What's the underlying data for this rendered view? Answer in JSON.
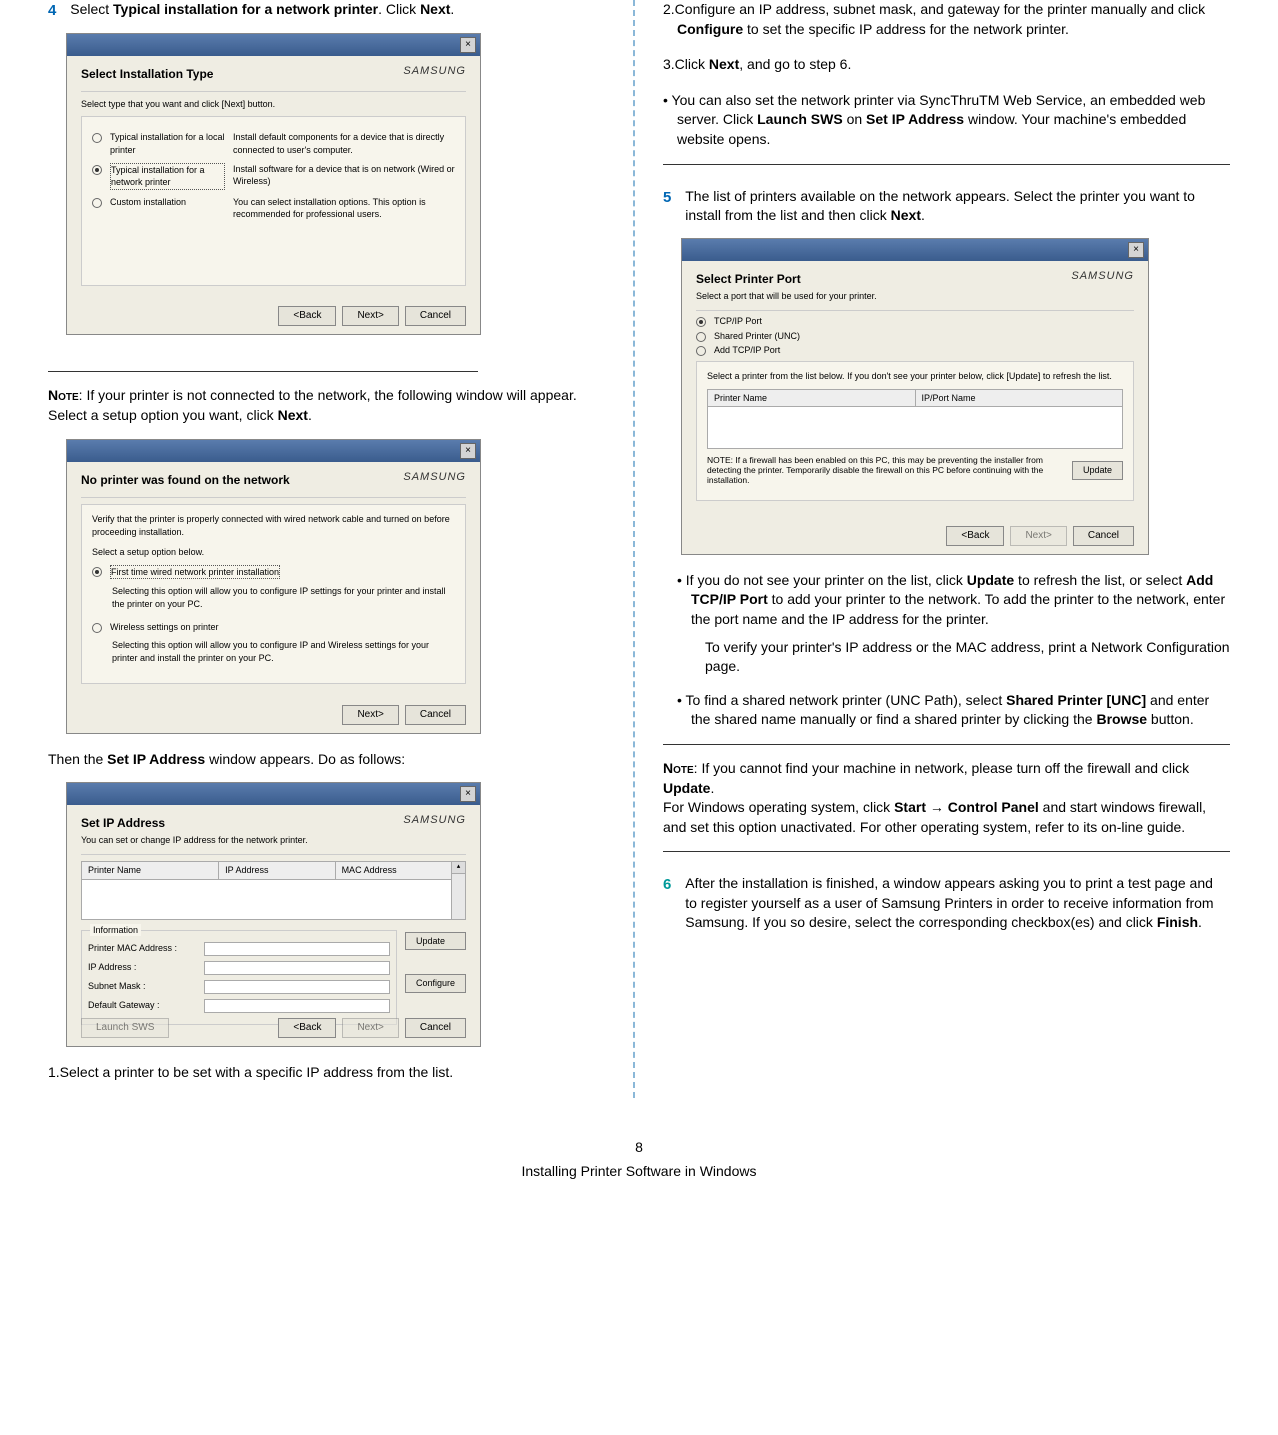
{
  "left": {
    "step4_num": "4",
    "step4_text_a": "Select ",
    "step4_bold": "Typical installation for a network printer",
    "step4_text_b": ". Click ",
    "step4_bold2": "Next",
    "step4_text_c": ".",
    "note_label": "Note",
    "note_text_a": ": If your printer is not connected to the network, the following window will appear. Select a setup option you want, click ",
    "note_bold": "Next",
    "note_text_b": ".",
    "then_a": "Then the ",
    "then_bold": "Set IP Address",
    "then_b": " window appears. Do as follows:",
    "sub1": "1.Select a printer to be set with a specific IP address from the list.",
    "dialog1": {
      "title": "Select Installation Type",
      "subtitle": "Select type that you want and click [Next] button.",
      "brand": "SAMSUNG",
      "r1_label": "Typical installation for a local printer",
      "r1_desc": "Install default components for a device that is directly connected to user's computer.",
      "r2_label": "Typical installation for a network printer",
      "r2_desc": "Install software for a device that is on network (Wired or Wireless)",
      "r3_label": "Custom installation",
      "r3_desc": "You can select installation options. This option is recommended for professional users.",
      "back": "<Back",
      "next": "Next>",
      "cancel": "Cancel"
    },
    "dialog2": {
      "title": "No printer was found on the network",
      "brand": "SAMSUNG",
      "line1": "Verify that the printer is properly connected with wired network cable and turned on before proceeding installation.",
      "line2": "Select a setup option below.",
      "r1_label": "First time wired network printer installation",
      "r1_desc": "Selecting this option will allow you to configure IP settings for your printer and install the printer on your PC.",
      "r2_label": "Wireless settings on printer",
      "r2_desc": "Selecting this option will allow you to configure IP and Wireless settings for your printer and install the printer on your PC.",
      "next": "Next>",
      "cancel": "Cancel"
    },
    "dialog3": {
      "title": "Set IP Address",
      "subtitle": "You can set or change IP address for the network printer.",
      "brand": "SAMSUNG",
      "col1": "Printer Name",
      "col2": "IP Address",
      "col3": "MAC Address",
      "group": "Information",
      "mac": "Printer MAC Address :",
      "ip": "IP Address :",
      "subnet": "Subnet Mask :",
      "gateway": "Default Gateway :",
      "update": "Update",
      "configure": "Configure",
      "launch": "Launch SWS",
      "back": "<Back",
      "next": "Next>",
      "cancel": "Cancel"
    }
  },
  "right": {
    "sub2_a": "2.Configure an IP address, subnet mask, and gateway for the printer manually and click ",
    "sub2_bold": "Configure",
    "sub2_b": " to set the specific IP address for the network printer.",
    "sub3_a": "3.Click ",
    "sub3_bold": "Next",
    "sub3_b": ", and go to step 6.",
    "bullet1_a": "• You can also set the network printer via SyncThruTM Web Service, an embedded web server. Click ",
    "bullet1_bold": "Launch SWS",
    "bullet1_b": " on ",
    "bullet1_bold2": "Set IP Address",
    "bullet1_c": " window. Your machine's embedded website opens.",
    "step5_num": "5",
    "step5_a": "The list of printers available on the network appears. Select the printer you want to install from the list and then click ",
    "step5_bold": "Next",
    "step5_b": ".",
    "bullet2_a": "• If you do not see your printer on the list, click ",
    "bullet2_bold": "Update",
    "bullet2_b": " to refresh the list, or select ",
    "bullet2_bold2": "Add TCP/IP Port",
    "bullet2_c": " to add your printer to the network. To add the printer to the network, enter the port name and the IP address for the printer.",
    "bullet2_verify": "To verify your printer's IP address or the MAC address, print a Network Configuration page.",
    "bullet3_a": "• To find a shared network printer (UNC Path), select ",
    "bullet3_bold": "Shared Printer [UNC]",
    "bullet3_b": " and enter the shared name manually or find a shared printer by clicking the ",
    "bullet3_bold2": "Browse",
    "bullet3_c": " button.",
    "note2_label": "Note",
    "note2_a": ": If you cannot find your machine in network, please turn off the firewall and click ",
    "note2_bold": "Update",
    "note2_b": ".",
    "note2_line2_a": "For Windows operating system, click ",
    "note2_start": "Start",
    "note2_arrow": " → ",
    "note2_cp": "Control Panel",
    "note2_line2_b": " and start windows firewall, and set this option unactivated. For other operating system, refer to its on-line guide.",
    "step6_num": "6",
    "step6_a": "After the installation is finished, a window appears asking you to print a test page and to register yourself as a user of Samsung Printers in order to receive information from Samsung. If you so desire, select the corresponding checkbox(es) and click ",
    "step6_bold": "Finish",
    "step6_b": ".",
    "dialog4": {
      "title": "Select Printer Port",
      "subtitle": "Select a port that will be used for your printer.",
      "brand": "SAMSUNG",
      "r1": "TCP/IP Port",
      "r2": "Shared Printer (UNC)",
      "r3": "Add TCP/IP Port",
      "inset_text": "Select a printer from the list below. If you don't see your printer below, click [Update] to refresh the list.",
      "col1": "Printer Name",
      "col2": "IP/Port Name",
      "note": "NOTE: If a firewall has been enabled on this PC, this may be preventing the installer from detecting the printer. Temporarily disable the firewall on this PC before continuing with the installation.",
      "update": "Update",
      "back": "<Back",
      "next": "Next>",
      "cancel": "Cancel"
    }
  },
  "footer": {
    "page": "8",
    "title": "Installing Printer Software in Windows"
  }
}
